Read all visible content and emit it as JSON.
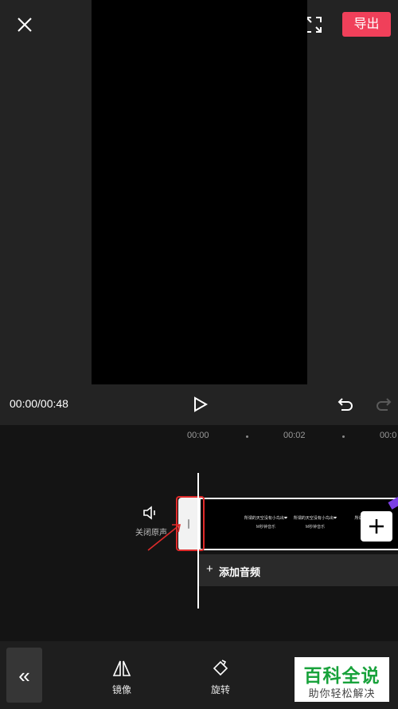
{
  "header": {
    "close_icon": "close-icon",
    "fullscreen_icon": "fullscreen-icon",
    "export_label": "导出",
    "accent_color": "#f0405a"
  },
  "player": {
    "time": "00:00/00:48",
    "play_icon": "play-icon",
    "undo_icon": "undo-icon",
    "redo_icon": "redo-icon"
  },
  "timeline": {
    "ruler": [
      "00:00",
      "00:02",
      "00:0"
    ],
    "mute_label": "关闭原声",
    "clip_texts": [
      {
        "line1": "所谓的天空没有小鸟出❤",
        "line2": "M秒钟音乐"
      },
      {
        "line1": "所谓的天空没有小鸟出❤",
        "line2": "M秒钟音乐"
      },
      {
        "line1": "所谓的天空",
        "line2": ""
      }
    ],
    "add_audio_label": "添加音频"
  },
  "toolbar": {
    "collapse_glyph": "«",
    "tools": [
      {
        "label": "镜像",
        "icon": "mirror-icon"
      },
      {
        "label": "旋转",
        "icon": "rotate-icon"
      }
    ]
  },
  "watermark": {
    "title": "百科全说",
    "subtitle": "助你轻松解决"
  }
}
